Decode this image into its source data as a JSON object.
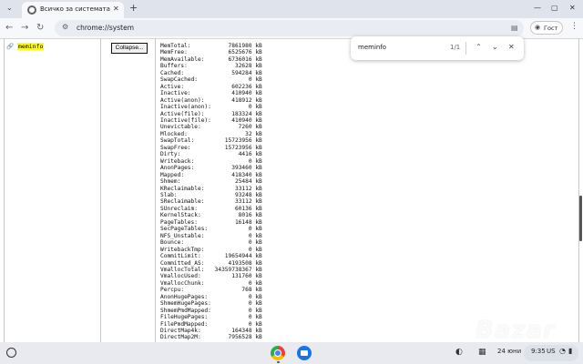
{
  "tab": {
    "title": "Всичко за системата",
    "favicon": "chrome-logo-icon"
  },
  "toolbar": {
    "url": "chrome://system",
    "guest_label": "Гост"
  },
  "page": {
    "key_name": "meminfo",
    "collapse_label": "Collapse...",
    "meminfo": [
      {
        "name": "MemTotal:",
        "value": "7861980 kB"
      },
      {
        "name": "MemFree:",
        "value": "6525676 kB"
      },
      {
        "name": "MemAvailable:",
        "value": "6736016 kB"
      },
      {
        "name": "Buffers:",
        "value": "32628 kB"
      },
      {
        "name": "Cached:",
        "value": "594284 kB"
      },
      {
        "name": "SwapCached:",
        "value": "0 kB"
      },
      {
        "name": "Active:",
        "value": "602236 kB"
      },
      {
        "name": "Inactive:",
        "value": "410940 kB"
      },
      {
        "name": "Active(anon):",
        "value": "418912 kB"
      },
      {
        "name": "Inactive(anon):",
        "value": "0 kB"
      },
      {
        "name": "Active(file):",
        "value": "183324 kB"
      },
      {
        "name": "Inactive(file):",
        "value": "410940 kB"
      },
      {
        "name": "Unevictable:",
        "value": "7260 kB"
      },
      {
        "name": "Mlocked:",
        "value": "32 kB"
      },
      {
        "name": "SwapTotal:",
        "value": "15723956 kB"
      },
      {
        "name": "SwapFree:",
        "value": "15723956 kB"
      },
      {
        "name": "Dirty:",
        "value": "4416 kB"
      },
      {
        "name": "Writeback:",
        "value": "0 kB"
      },
      {
        "name": "AnonPages:",
        "value": "393460 kB"
      },
      {
        "name": "Mapped:",
        "value": "418340 kB"
      },
      {
        "name": "Shmem:",
        "value": "25484 kB"
      },
      {
        "name": "KReclaimable:",
        "value": "33112 kB"
      },
      {
        "name": "Slab:",
        "value": "93248 kB"
      },
      {
        "name": "SReclaimable:",
        "value": "33112 kB"
      },
      {
        "name": "SUnreclaim:",
        "value": "60136 kB"
      },
      {
        "name": "KernelStack:",
        "value": "8016 kB"
      },
      {
        "name": "PageTables:",
        "value": "16148 kB"
      },
      {
        "name": "SecPageTables:",
        "value": "0 kB"
      },
      {
        "name": "NFS_Unstable:",
        "value": "0 kB"
      },
      {
        "name": "Bounce:",
        "value": "0 kB"
      },
      {
        "name": "WritebackTmp:",
        "value": "0 kB"
      },
      {
        "name": "CommitLimit:",
        "value": "19654944 kB"
      },
      {
        "name": "Committed_AS:",
        "value": "4193508 kB"
      },
      {
        "name": "VmallocTotal:",
        "value": "34359738367 kB"
      },
      {
        "name": "VmallocUsed:",
        "value": "131760 kB"
      },
      {
        "name": "VmallocChunk:",
        "value": "0 kB"
      },
      {
        "name": "Percpu:",
        "value": "768 kB"
      },
      {
        "name": "AnonHugePages:",
        "value": "0 kB"
      },
      {
        "name": "ShmemHugePages:",
        "value": "0 kB"
      },
      {
        "name": "ShmemPmdMapped:",
        "value": "0 kB"
      },
      {
        "name": "FileHugePages:",
        "value": "0 kB"
      },
      {
        "name": "FilePmdMapped:",
        "value": "0 kB"
      },
      {
        "name": "DirectMap4k:",
        "value": "164348 kB"
      },
      {
        "name": "DirectMap2M:",
        "value": "7956528 kB"
      }
    ]
  },
  "find": {
    "query": "meminfo",
    "count": "1/1"
  },
  "shelf": {
    "date": "24 юни",
    "time": "9:35",
    "region": "US"
  },
  "watermark": "Bazar"
}
